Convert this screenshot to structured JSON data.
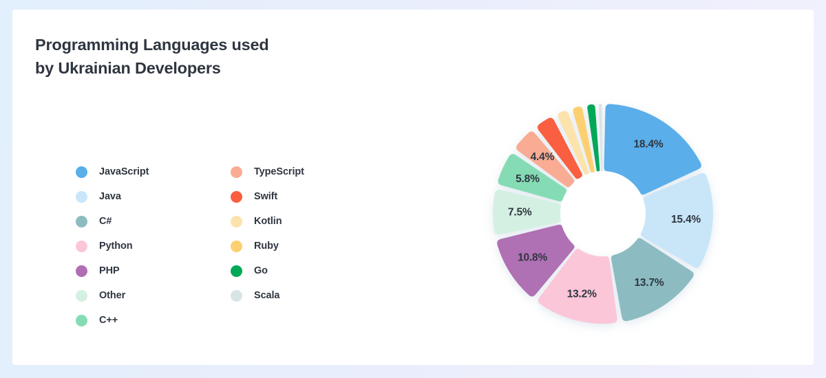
{
  "title": {
    "line1": "Programming Languages used",
    "line2": "by Ukrainian Developers"
  },
  "legend": {
    "columns": [
      {
        "items": [
          {
            "label": "JavaScript",
            "color": "#5aaeea"
          },
          {
            "label": "Java",
            "color": "#c9e6f8"
          },
          {
            "label": "C#",
            "color": "#8cbcc2"
          },
          {
            "label": "Python",
            "color": "#fbc6d8"
          },
          {
            "label": "PHP",
            "color": "#b06fb4"
          },
          {
            "label": "Other",
            "color": "#d4f0e2"
          },
          {
            "label": "C++",
            "color": "#85dcb4"
          }
        ]
      },
      {
        "items": [
          {
            "label": "TypeScript",
            "color": "#f9ac93"
          },
          {
            "label": "Swift",
            "color": "#f95f3f"
          },
          {
            "label": "Kotlin",
            "color": "#fbe3ab"
          },
          {
            "label": "Ruby",
            "color": "#fcd071"
          },
          {
            "label": "Go",
            "color": "#00a859"
          },
          {
            "label": "Scala",
            "color": "#d8e5e5"
          }
        ]
      }
    ]
  },
  "chart_data": {
    "type": "pie",
    "title": "Programming Languages used by Ukrainian Developers",
    "subtitle": "",
    "xlabel": "",
    "ylabel": "",
    "legend_position": "left",
    "donut": true,
    "inner_radius_ratio": 0.39,
    "start_angle_deg": 0,
    "direction": "clockwise",
    "categories": [
      "JavaScript",
      "Java",
      "C#",
      "Python",
      "PHP",
      "Other",
      "C++",
      "TypeScript",
      "Swift",
      "Kotlin",
      "Ruby",
      "Go",
      "Scala"
    ],
    "values": [
      18.4,
      15.4,
      13.7,
      13.2,
      10.8,
      7.5,
      5.8,
      4.4,
      3.5,
      2.4,
      2.2,
      1.9,
      0.8
    ],
    "colors": [
      "#5aaeea",
      "#c9e6f8",
      "#8cbcc2",
      "#fbc6d8",
      "#b06fb4",
      "#d4f0e2",
      "#85dcb4",
      "#f9ac93",
      "#f95f3f",
      "#fbe3ab",
      "#fcd071",
      "#00a859",
      "#d8e5e5"
    ],
    "slices": [
      {
        "label": "JavaScript",
        "value": 18.4,
        "display": "18.4%",
        "color": "#5aaeea",
        "show_label": true
      },
      {
        "label": "Java",
        "value": 15.4,
        "display": "15.4%",
        "color": "#c9e6f8",
        "show_label": true
      },
      {
        "label": "C#",
        "value": 13.7,
        "display": "13.7%",
        "color": "#8cbcc2",
        "show_label": true
      },
      {
        "label": "Python",
        "value": 13.2,
        "display": "13.2%",
        "color": "#fbc6d8",
        "show_label": true
      },
      {
        "label": "PHP",
        "value": 10.8,
        "display": "10.8%",
        "color": "#b06fb4",
        "show_label": true
      },
      {
        "label": "Other",
        "value": 7.5,
        "display": "7.5%",
        "color": "#d4f0e2",
        "show_label": true
      },
      {
        "label": "C++",
        "value": 5.8,
        "display": "5.8%",
        "color": "#85dcb4",
        "show_label": true
      },
      {
        "label": "TypeScript",
        "value": 4.4,
        "display": "4.4%",
        "color": "#f9ac93",
        "show_label": true
      },
      {
        "label": "Swift",
        "value": 3.5,
        "display": "3.5%",
        "color": "#f95f3f",
        "show_label": false
      },
      {
        "label": "Kotlin",
        "value": 2.4,
        "display": "2.4%",
        "color": "#fbe3ab",
        "show_label": false
      },
      {
        "label": "Ruby",
        "value": 2.2,
        "display": "2.2%",
        "color": "#fcd071",
        "show_label": false
      },
      {
        "label": "Go",
        "value": 1.9,
        "display": "1.9%",
        "color": "#00a859",
        "show_label": false
      },
      {
        "label": "Scala",
        "value": 0.8,
        "display": "0.8%",
        "color": "#d8e5e5",
        "show_label": false
      }
    ]
  }
}
